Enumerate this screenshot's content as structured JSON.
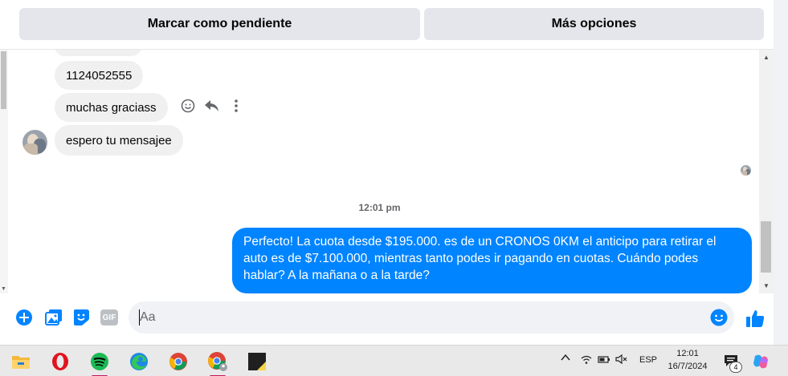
{
  "top_actions": {
    "cut_text": "...",
    "mark_pending_label": "Marcar como pendiente",
    "more_options_label": "Más opciones"
  },
  "conversation": {
    "incoming": [
      {
        "text": "1124052555"
      },
      {
        "text": "muchas graciass"
      },
      {
        "text": "espero tu mensajee"
      }
    ],
    "message_actions": [
      "react-icon",
      "reply-icon",
      "more-vert-icon"
    ],
    "timestamp": "12:01 pm",
    "outgoing": {
      "text": "Perfecto! La cuota desde $195.000. es de un CRONOS 0KM el anticipo para retirar el auto es de $7.100.000, mientras tanto podes ir pagando en cuotas. Cuándo podes hablar? A la mañana o a la tarde?"
    }
  },
  "composer": {
    "placeholder": "Aa",
    "gif_label": "GIF",
    "icons": [
      "plus-circle-icon",
      "photo-icon",
      "sticker-icon",
      "gif-icon",
      "emoji-icon",
      "thumbs-up-icon"
    ]
  },
  "taskbar": {
    "apps": [
      "file-explorer-icon",
      "opera-icon",
      "spotify-icon",
      "edge-icon",
      "chrome-icon",
      "chrome-profile-icon",
      "sticky-app-icon"
    ],
    "language": "ESP",
    "time": "12:01",
    "date": "16/7/2024",
    "notification_count": "4"
  },
  "colors": {
    "accent": "#0084ff",
    "incoming_bubble": "#f0f0f0",
    "button_bg": "#e4e6eb",
    "taskbar_bg": "#e9e9ea"
  }
}
